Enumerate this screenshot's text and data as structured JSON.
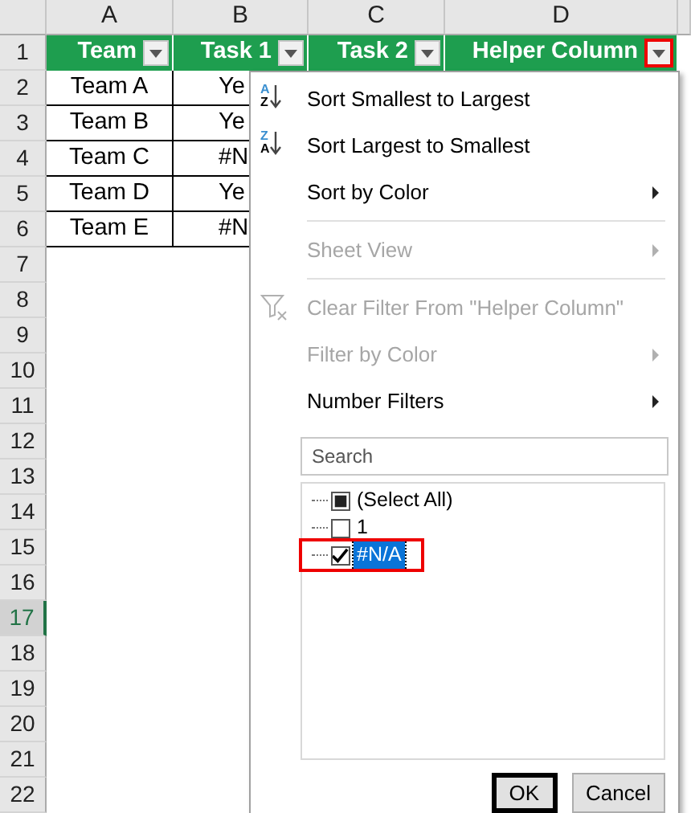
{
  "column_headers": [
    "A",
    "B",
    "C",
    "D"
  ],
  "row_headers": [
    {
      "label": "1",
      "selected": false
    },
    {
      "label": "2",
      "selected": false
    },
    {
      "label": "3",
      "selected": false
    },
    {
      "label": "4",
      "selected": false
    },
    {
      "label": "5",
      "selected": false
    },
    {
      "label": "6",
      "selected": false
    },
    {
      "label": "7",
      "selected": false
    },
    {
      "label": "8",
      "selected": false
    },
    {
      "label": "9",
      "selected": false
    },
    {
      "label": "10",
      "selected": false
    },
    {
      "label": "11",
      "selected": false
    },
    {
      "label": "12",
      "selected": false
    },
    {
      "label": "13",
      "selected": false
    },
    {
      "label": "14",
      "selected": false
    },
    {
      "label": "15",
      "selected": false
    },
    {
      "label": "16",
      "selected": false
    },
    {
      "label": "17",
      "selected": true
    },
    {
      "label": "18",
      "selected": false
    },
    {
      "label": "19",
      "selected": false
    },
    {
      "label": "20",
      "selected": false
    },
    {
      "label": "21",
      "selected": false
    },
    {
      "label": "22",
      "selected": false
    }
  ],
  "header_row": [
    {
      "text": "Team",
      "highlighted": false
    },
    {
      "text": "Task 1",
      "highlighted": false
    },
    {
      "text": "Task 2",
      "highlighted": false
    },
    {
      "text": "Helper Column",
      "highlighted": true
    }
  ],
  "data_rows": [
    [
      "Team A",
      "Ye"
    ],
    [
      "Team B",
      "Ye"
    ],
    [
      "Team C",
      "#N"
    ],
    [
      "Team D",
      "Ye"
    ],
    [
      "Team E",
      "#N"
    ]
  ],
  "menu": {
    "items": [
      {
        "kind": "sort",
        "icon_letters": [
          "A",
          "Z"
        ],
        "label": "Sort Smallest to Largest",
        "disabled": false,
        "submenu": false
      },
      {
        "kind": "sort",
        "icon_letters": [
          "Z",
          "A"
        ],
        "label": "Sort Largest to Smallest",
        "disabled": false,
        "submenu": false
      },
      {
        "kind": "item",
        "label": "Sort by Color",
        "disabled": false,
        "submenu": true
      },
      {
        "kind": "divider"
      },
      {
        "kind": "item",
        "label": "Sheet View",
        "disabled": true,
        "submenu": true
      },
      {
        "kind": "divider"
      },
      {
        "kind": "clear",
        "label": "Clear Filter From \"Helper Column\"",
        "disabled": true,
        "submenu": false
      },
      {
        "kind": "item",
        "label": "Filter by Color",
        "disabled": true,
        "submenu": true
      },
      {
        "kind": "item",
        "label": "Number Filters",
        "disabled": false,
        "submenu": true
      }
    ],
    "search": {
      "placeholder": "Search"
    },
    "values": [
      {
        "label": "(Select All)",
        "checked": false,
        "mixed": true,
        "selected": false,
        "highlighted": false
      },
      {
        "label": "1",
        "checked": false,
        "mixed": false,
        "selected": false,
        "highlighted": false
      },
      {
        "label": "#N/A",
        "checked": true,
        "mixed": false,
        "selected": true,
        "highlighted": true
      }
    ],
    "buttons": [
      {
        "label": "OK",
        "focused": true
      },
      {
        "label": "Cancel",
        "focused": false
      }
    ]
  }
}
